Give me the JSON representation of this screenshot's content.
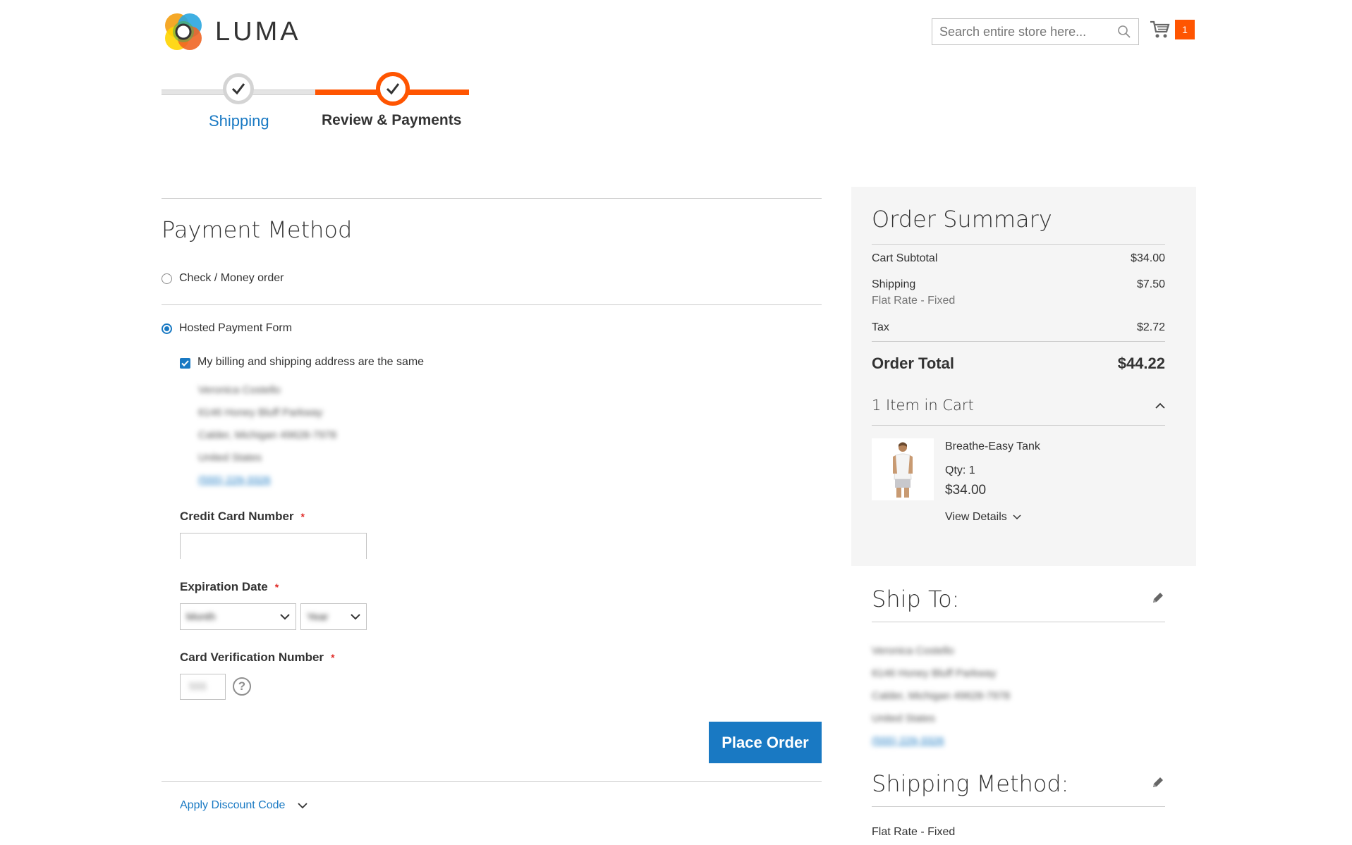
{
  "brand": {
    "name": "LUMA",
    "accent": "#ff5501",
    "link": "#1979c3"
  },
  "header": {
    "search_placeholder": "Search entire store here...",
    "cart_count": "1"
  },
  "progress": {
    "steps": [
      {
        "label": "Shipping",
        "state": "complete"
      },
      {
        "label": "Review & Payments",
        "state": "active"
      }
    ]
  },
  "payment": {
    "title": "Payment Method",
    "options": [
      {
        "label": "Check / Money order",
        "selected": false
      },
      {
        "label": "Hosted Payment Form",
        "selected": true
      }
    ],
    "same_address_label": "My billing and shipping address are the same",
    "billing_address": {
      "name": "Veronica Costello",
      "street": "6146 Honey Bluff Parkway",
      "city_line": "Calder, Michigan 49628-7978",
      "country": "United States",
      "phone": "(555) 229-3326"
    },
    "cc_number_label": "Credit Card Number",
    "required_mark": "*",
    "expiration_label": "Expiration Date",
    "month_placeholder": "Month",
    "year_placeholder": "Year",
    "cvv_label": "Card Verification Number",
    "cvv_placeholder": "555",
    "help_glyph": "?",
    "place_order": "Place Order",
    "discount_link": "Apply Discount Code"
  },
  "summary": {
    "title": "Order Summary",
    "cart_subtotal_label": "Cart Subtotal",
    "cart_subtotal_value": "$34.00",
    "shipping_label": "Shipping",
    "shipping_value": "$7.50",
    "shipping_method": "Flat Rate - Fixed",
    "tax_label": "Tax",
    "tax_value": "$2.72",
    "order_total_label": "Order Total",
    "order_total_value": "$44.22",
    "items_in_cart": "1 Item in Cart",
    "item": {
      "name": "Breathe-Easy Tank",
      "qty": "Qty: 1",
      "price": "$34.00",
      "view_details": "View Details"
    }
  },
  "ship_to": {
    "title": "Ship To:",
    "name": "Veronica Costello",
    "street": "6146 Honey Bluff Parkway",
    "city_line": "Calder, Michigan 49628-7978",
    "country": "United States",
    "phone": "(555) 229-3326"
  },
  "shipping_method": {
    "title": "Shipping Method:",
    "value": "Flat Rate - Fixed"
  }
}
